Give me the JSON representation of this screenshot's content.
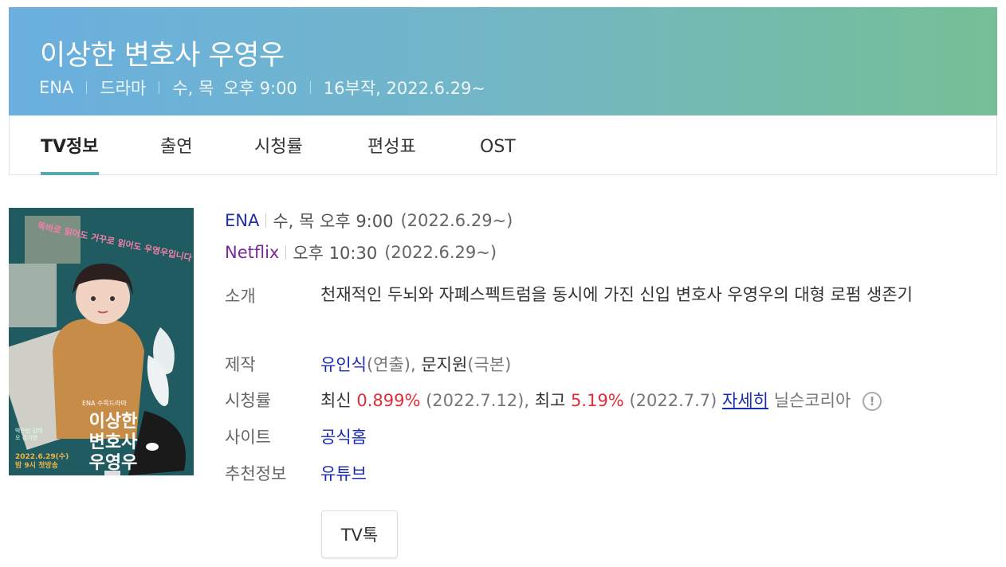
{
  "header": {
    "title": "이상한 변호사 우영우",
    "channel": "ENA",
    "genre": "드라마",
    "days": "수, 목",
    "time": "오후 9:00",
    "episodes_date": "16부작, 2022.6.29~"
  },
  "tabs": [
    {
      "label": "TV정보",
      "active": true
    },
    {
      "label": "출연",
      "active": false
    },
    {
      "label": "시청률",
      "active": false
    },
    {
      "label": "편성표",
      "active": false
    },
    {
      "label": "OST",
      "active": false
    }
  ],
  "poster": {
    "title_line1": "이상한",
    "title_line2": "변호사",
    "title_line3": "우영우",
    "tagline": "똑바로 읽어도 거꾸로 읽어도 우영우입니다",
    "broadcaster": "ENA 수목드라마",
    "date_line1": "2022.6.29(수)",
    "date_line2": "밤 9시 첫방송",
    "cast": "박은빈 강태오 강기영"
  },
  "broadcasts": [
    {
      "channel": "ENA",
      "time": "수, 목 오후 9:00",
      "date": "(2022.6.29~)"
    },
    {
      "channel": "Netflix",
      "time": "오후 10:30",
      "date": "(2022.6.29~)"
    }
  ],
  "details": {
    "intro_label": "소개",
    "intro_text": "천재적인 두뇌와 자폐스펙트럼을 동시에 가진 신입 변호사 우영우의 대형 로펌 생존기",
    "production_label": "제작",
    "director_name": "유인식",
    "director_role": "(연출),",
    "writer_name": "문지원",
    "writer_role": "(극본)",
    "ratings_label": "시청률",
    "latest_label": "최신",
    "latest_value": "0.899%",
    "latest_date": "(2022.7.12),",
    "best_label": "최고",
    "best_value": "5.19%",
    "best_date": "(2022.7.7)",
    "more_link": "자세히",
    "source": "닐슨코리아",
    "help_icon_glyph": "!",
    "site_label": "사이트",
    "site_link": "공식홈",
    "recommend_label": "추천정보",
    "recommend_link": "유튜브"
  },
  "talk_button": "TV톡"
}
